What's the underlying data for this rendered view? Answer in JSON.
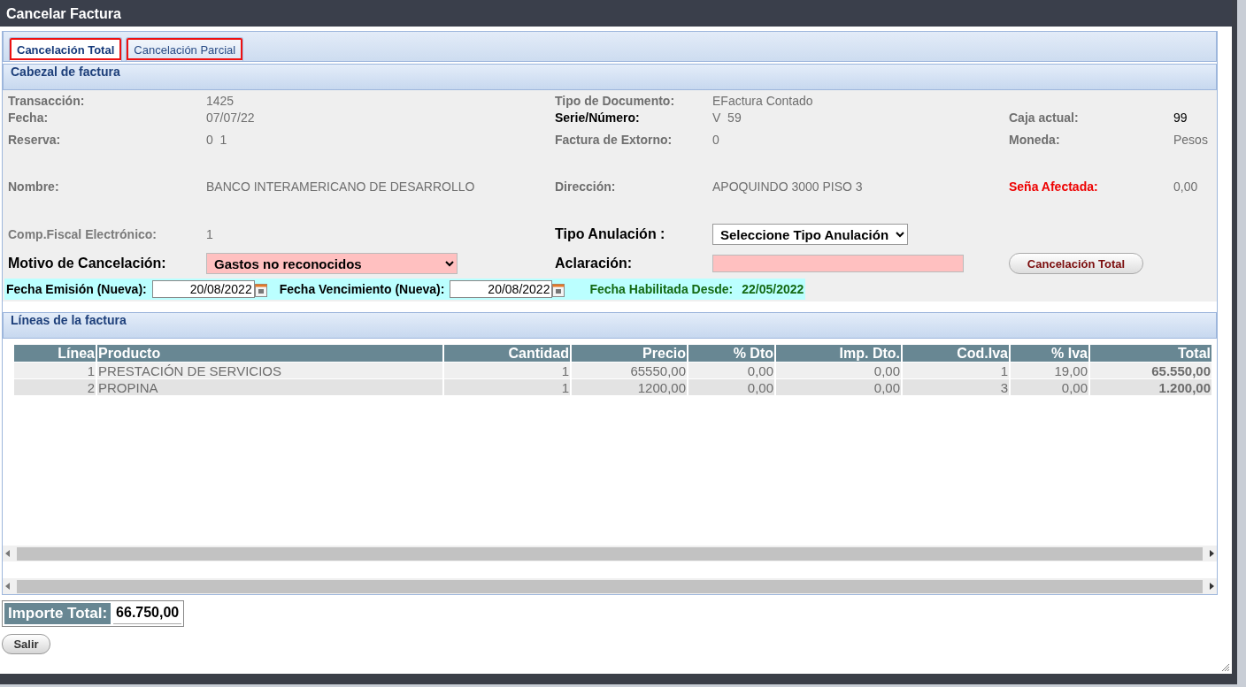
{
  "window": {
    "title": "Cancelar Factura"
  },
  "tabs": [
    {
      "label": "Cancelación Total",
      "selected": true
    },
    {
      "label": "Cancelación Parcial",
      "selected": false
    }
  ],
  "header": {
    "title": "Cabezal de factura",
    "rows": [
      [
        {
          "label": "Transacción:",
          "value": "1425",
          "kind": "plain"
        },
        {
          "label": "Tipo de Documento:",
          "value": "EFactura Contado",
          "kind": "plain"
        }
      ],
      [
        {
          "label": "Fecha:",
          "value": "07/07/22",
          "kind": "plain"
        },
        {
          "label": "Serie/Número:",
          "value": "V  59",
          "kind": "strong-label"
        },
        {
          "label": "Caja actual:",
          "value": "99",
          "kind": "strong-value"
        }
      ],
      [
        {
          "label": "Reserva:",
          "value": "0  1",
          "kind": "plain"
        },
        {
          "label": "Factura de Extorno:",
          "value": "0",
          "kind": "plain"
        },
        {
          "label": "Moneda:",
          "value": "Pesos",
          "kind": "plain"
        }
      ],
      [
        {
          "label": "Nombre:",
          "value": "BANCO INTERAMERICANO DE DESARROLLO",
          "kind": "plain"
        },
        {
          "label": "Dirección:",
          "value": "APOQUINDO 3000 PISO 3",
          "kind": "plain"
        },
        {
          "label": "Seña Afectada:",
          "value": "0,00",
          "kind": "alert"
        }
      ]
    ],
    "controls": [
      [
        {
          "kind": "text",
          "label": "Comp.Fiscal Electrónico:",
          "value": "1"
        },
        {
          "kind": "select",
          "label": "Tipo Anulación :",
          "value": "Seleccione Tipo Anulación",
          "highlighted": false
        }
      ],
      [
        {
          "kind": "select",
          "label": "Motivo de Cancelación:",
          "value": "Gastos no reconocidos",
          "highlighted": true
        },
        {
          "kind": "input",
          "label": "Aclaración:",
          "highlighted": true
        },
        {
          "kind": "button",
          "label": "Cancelación Total"
        }
      ]
    ],
    "dates": [
      {
        "label": "Fecha Emisión (Nueva):",
        "value": "20/08/2022"
      },
      {
        "label": "Fecha Vencimiento (Nueva):",
        "value": "20/08/2022"
      }
    ],
    "enabled_from": {
      "label": "Fecha Habilitada Desde:",
      "value": "22/05/2022"
    }
  },
  "lines": {
    "title": "Líneas de la factura",
    "columns": [
      "Línea",
      "Producto",
      "Cantidad",
      "Precio",
      "% Dto",
      "Imp. Dto.",
      "Cod.Iva",
      "% Iva",
      "Total"
    ],
    "rows": [
      [
        "1",
        "PRESTACIÓN DE SERVICIOS",
        "1",
        "65550,00",
        "0,00",
        "0,00",
        "1",
        "19,00",
        "65.550,00"
      ],
      [
        "2",
        "PROPINA",
        "1",
        "1200,00",
        "0,00",
        "0,00",
        "3",
        "0,00",
        "1.200,00"
      ]
    ]
  },
  "total": {
    "label": "Importe Total:",
    "value": "66.750,00"
  },
  "buttons": [
    "Salir"
  ]
}
